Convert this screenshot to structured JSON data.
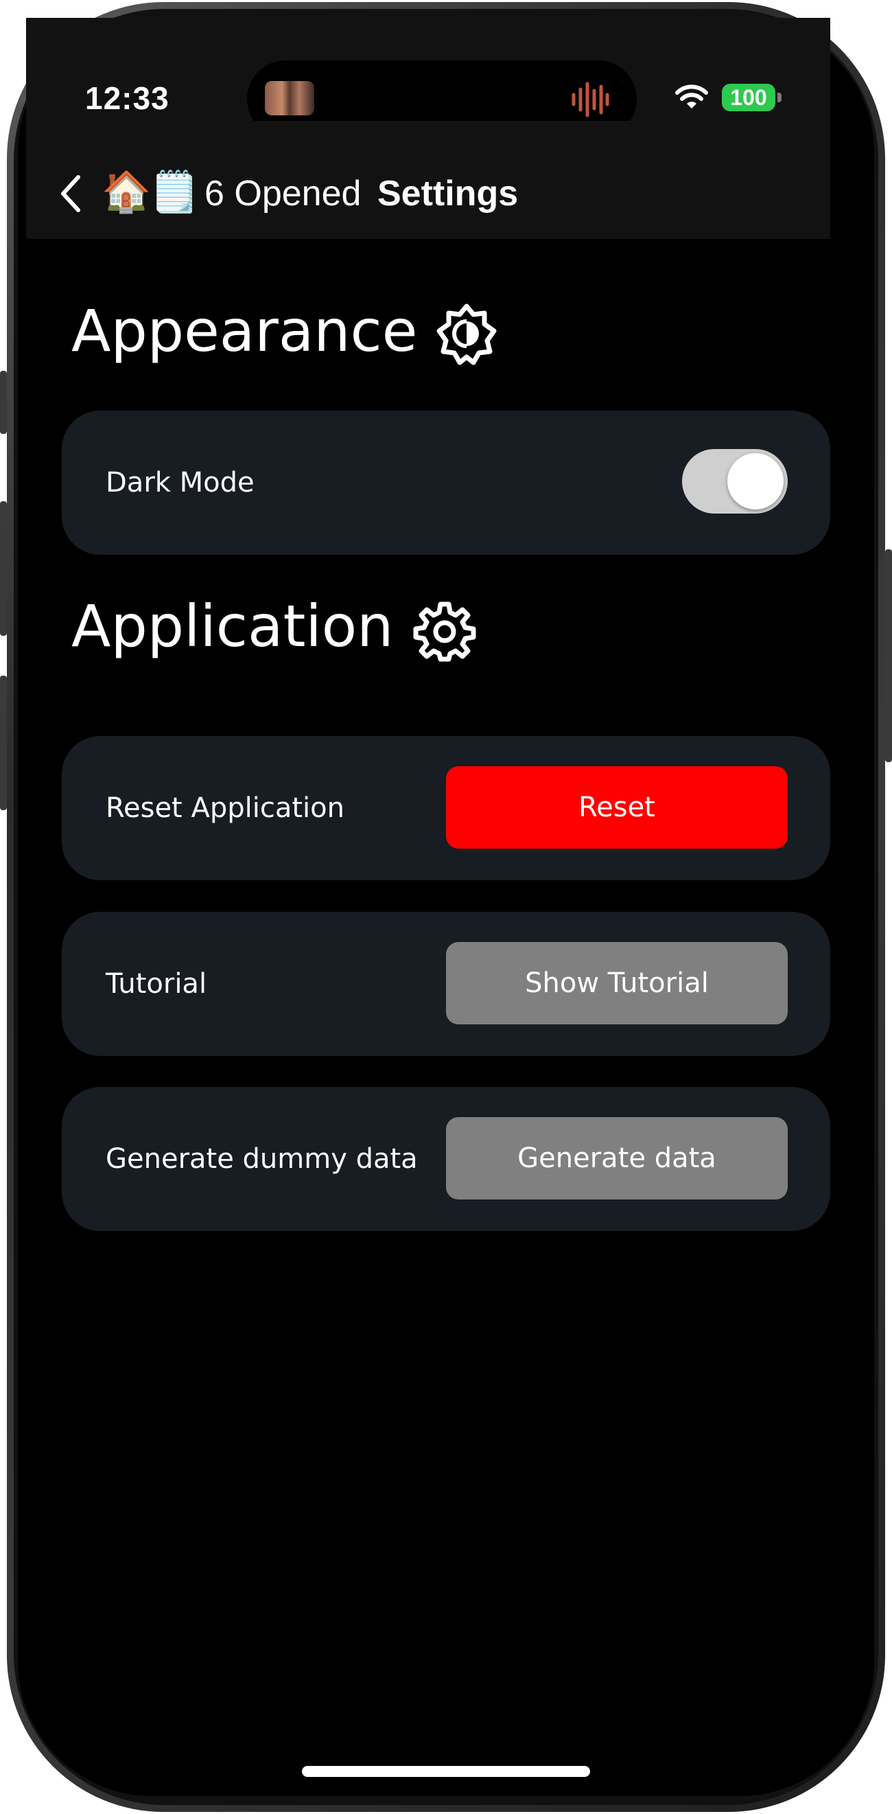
{
  "status_bar": {
    "time": "12:33",
    "battery": "100"
  },
  "nav": {
    "house_emoji": "🏠",
    "note_emoji": "🗒️",
    "open_count": "6 Opened",
    "title": "Settings"
  },
  "sections": {
    "appearance": {
      "title": "Appearance",
      "icon": "brightness-icon",
      "dark_mode": {
        "label": "Dark Mode",
        "enabled": true
      }
    },
    "application": {
      "title": "Application",
      "icon": "gear-icon",
      "reset": {
        "label": "Reset Application",
        "button": "Reset"
      },
      "tutorial": {
        "label": "Tutorial",
        "button": "Show Tutorial"
      },
      "dummy_data": {
        "label": "Generate dummy data",
        "button": "Generate data"
      }
    }
  },
  "colors": {
    "background": "#000000",
    "card": "#181c23",
    "danger": "#ff0000",
    "neutral_button": "#808080",
    "toggle_track": "#cfcfcf",
    "battery": "#2ec94f"
  }
}
